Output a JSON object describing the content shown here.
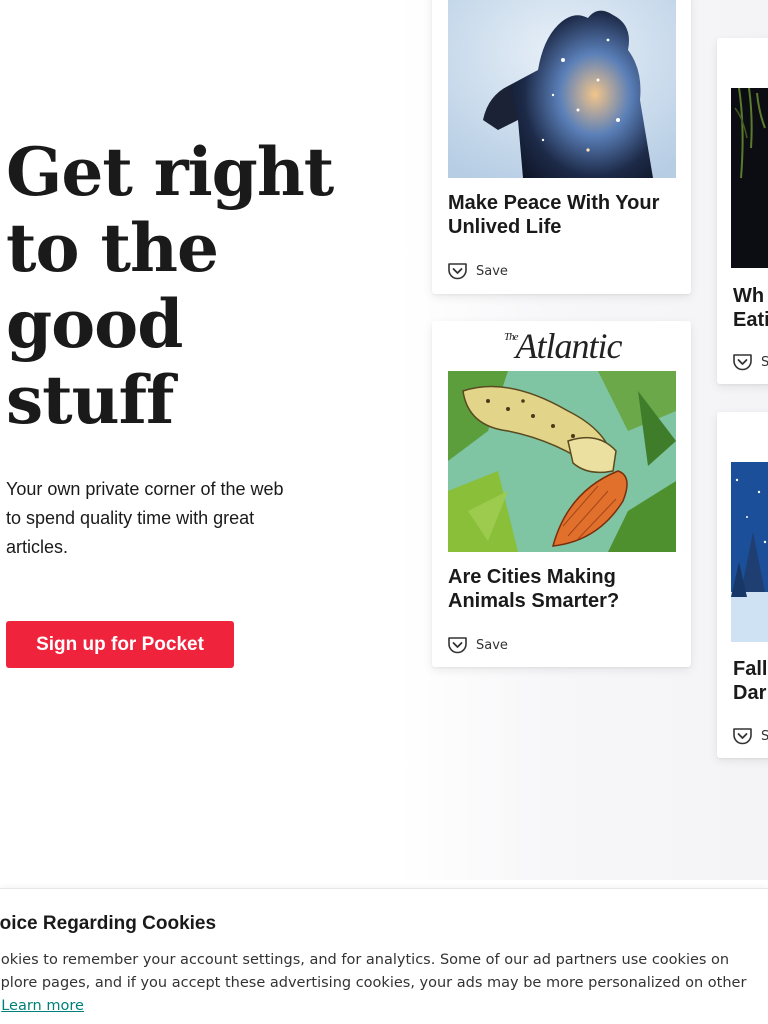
{
  "hero": {
    "title_lines": [
      "Get right",
      "to the",
      "good",
      "stuff"
    ],
    "subtitle": "Your own private corner of the web to spend quality time with great articles.",
    "cta_label": "Sign up for Pocket"
  },
  "cards": [
    {
      "title": "Make Peace With Your Unlived Life",
      "save_label": "Save"
    },
    {
      "publisher_prefix": "The",
      "publisher": "Atlantic",
      "title": "Are Cities Making Animals Smarter?",
      "save_label": "Save"
    },
    {
      "title": "Why Eati",
      "title_lines": [
        "Wh",
        "Eati"
      ],
      "save_label": "Sa"
    },
    {
      "title_lines": [
        "Fall",
        "Dar"
      ],
      "save_label": "Sa"
    }
  ],
  "cookie_banner": {
    "title": "hoice Regarding Cookies",
    "line1": "ookies to remember your account settings, and for analytics. Some of our ad partners use cookies on",
    "line2": "xplore pages, and if you accept these advertising cookies, your ads may be more personalized on other",
    "line3_prefix": ".",
    "learn_more": "Learn more"
  },
  "colors": {
    "brand_red": "#ef233c",
    "link_teal": "#008078",
    "text": "#1a1a1a"
  },
  "icons": {
    "save": "pocket-icon"
  }
}
